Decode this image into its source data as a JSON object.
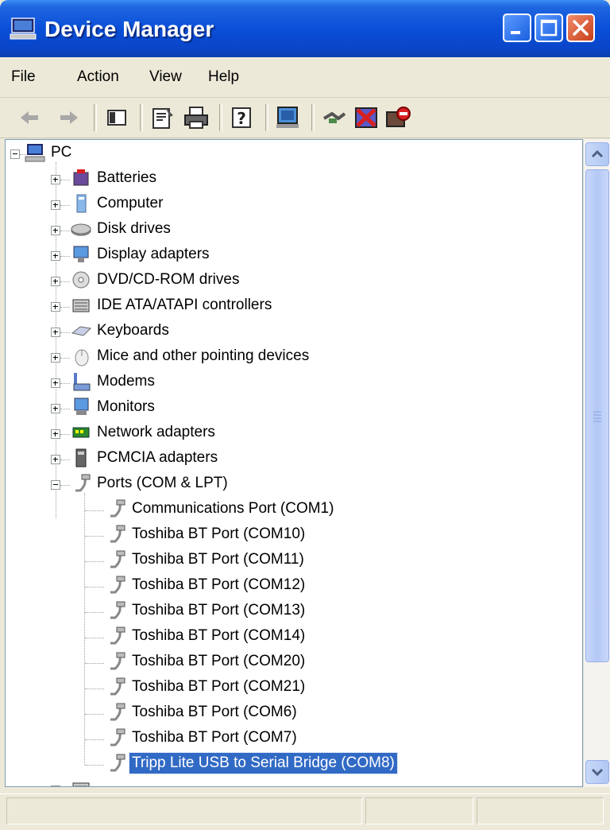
{
  "window": {
    "title": "Device Manager"
  },
  "menu": {
    "file": "File",
    "action": "Action",
    "view": "View",
    "help": "Help"
  },
  "tree": {
    "root": "PC",
    "categories": [
      "Batteries",
      "Computer",
      "Disk drives",
      "Display adapters",
      "DVD/CD-ROM drives",
      "IDE ATA/ATAPI controllers",
      "Keyboards",
      "Mice and other pointing devices",
      "Modems",
      "Monitors",
      "Network adapters",
      "PCMCIA adapters",
      "Ports (COM & LPT)"
    ],
    "ports": [
      "Communications Port (COM1)",
      "Toshiba BT Port (COM10)",
      "Toshiba BT Port (COM11)",
      "Toshiba BT Port (COM12)",
      "Toshiba BT Port (COM13)",
      "Toshiba BT Port (COM14)",
      "Toshiba BT Port (COM20)",
      "Toshiba BT Port (COM21)",
      "Toshiba BT Port (COM6)",
      "Toshiba BT Port (COM7)",
      "Tripp Lite USB to Serial Bridge (COM8)"
    ],
    "selected": "Tripp Lite USB to Serial Bridge (COM8)"
  },
  "colors": {
    "titlebar": "#0a4fd8",
    "selection": "#316ac5",
    "chrome": "#ece9d8"
  },
  "icons": {
    "toolbar": [
      "back-arrow-icon",
      "forward-arrow-icon",
      "show-hide-tree-icon",
      "properties-icon",
      "print-icon",
      "help-icon",
      "scan-hardware-icon",
      "update-driver-icon",
      "uninstall-icon",
      "disable-device-icon"
    ]
  }
}
